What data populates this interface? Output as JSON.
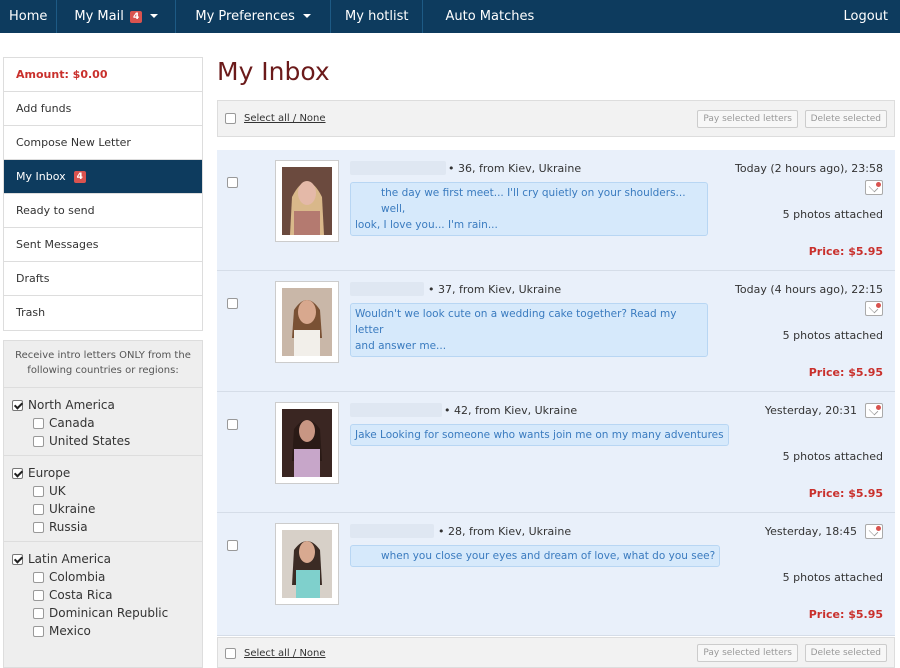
{
  "nav": {
    "home": "Home",
    "my_mail": "My Mail",
    "my_mail_badge": "4",
    "my_preferences": "My Preferences",
    "my_hotlist": "My hotlist",
    "auto_matches": "Auto Matches",
    "logout": "Logout"
  },
  "sidebar": {
    "amount": "Amount: $0.00",
    "items": [
      {
        "label": "Add funds"
      },
      {
        "label": "Compose New Letter"
      },
      {
        "label": "My Inbox",
        "badge": "4"
      },
      {
        "label": "Ready to send"
      },
      {
        "label": "Sent Messages"
      },
      {
        "label": "Drafts"
      },
      {
        "label": "Trash"
      }
    ]
  },
  "filters": {
    "intro": "Receive intro letters ONLY from the following countries or regions:",
    "regions": [
      {
        "name": "North America",
        "checked": true,
        "countries": [
          "Canada",
          "United States"
        ]
      },
      {
        "name": "Europe",
        "checked": true,
        "countries": [
          "UK",
          "Ukraine",
          "Russia"
        ]
      },
      {
        "name": "Latin America",
        "checked": true,
        "countries": [
          "Colombia",
          "Costa Rica",
          "Dominican Republic",
          "Mexico"
        ]
      }
    ]
  },
  "main": {
    "title": "My Inbox",
    "select_all": "Select all / None",
    "pay_selected": "Pay selected letters",
    "delete_selected": "Delete selected"
  },
  "letters": [
    {
      "meta": "• 36, from Kiev, Ukraine",
      "text_line1": "the day we first meet... I'll cry quietly on your shoulders... well,",
      "text_line2": "look, I love you... I'm rain...",
      "date": "Today (2 hours ago), 23:58",
      "photos": "5 photos attached",
      "price": "Price: $5.95"
    },
    {
      "meta": "• 37, from Kiev, Ukraine",
      "text_line1": "Wouldn't we look cute on a wedding cake together? Read my letter",
      "text_line2": "and answer me...",
      "date": "Today (4 hours ago), 22:15",
      "photos": "5 photos attached",
      "price": "Price: $5.95"
    },
    {
      "meta": "• 42, from Kiev, Ukraine",
      "text_line1": "Jake Looking for someone who wants join me on my many adventures",
      "text_line2": "",
      "date": "Yesterday, 20:31",
      "photos": "5 photos attached",
      "price": "Price: $5.95"
    },
    {
      "meta": "• 28, from Kiev, Ukraine",
      "text_line1": "when you close your eyes and dream of love, what do you see?",
      "text_line2": "",
      "date": "Yesterday, 18:45",
      "photos": "5 photos attached",
      "price": "Price: $5.95"
    }
  ]
}
